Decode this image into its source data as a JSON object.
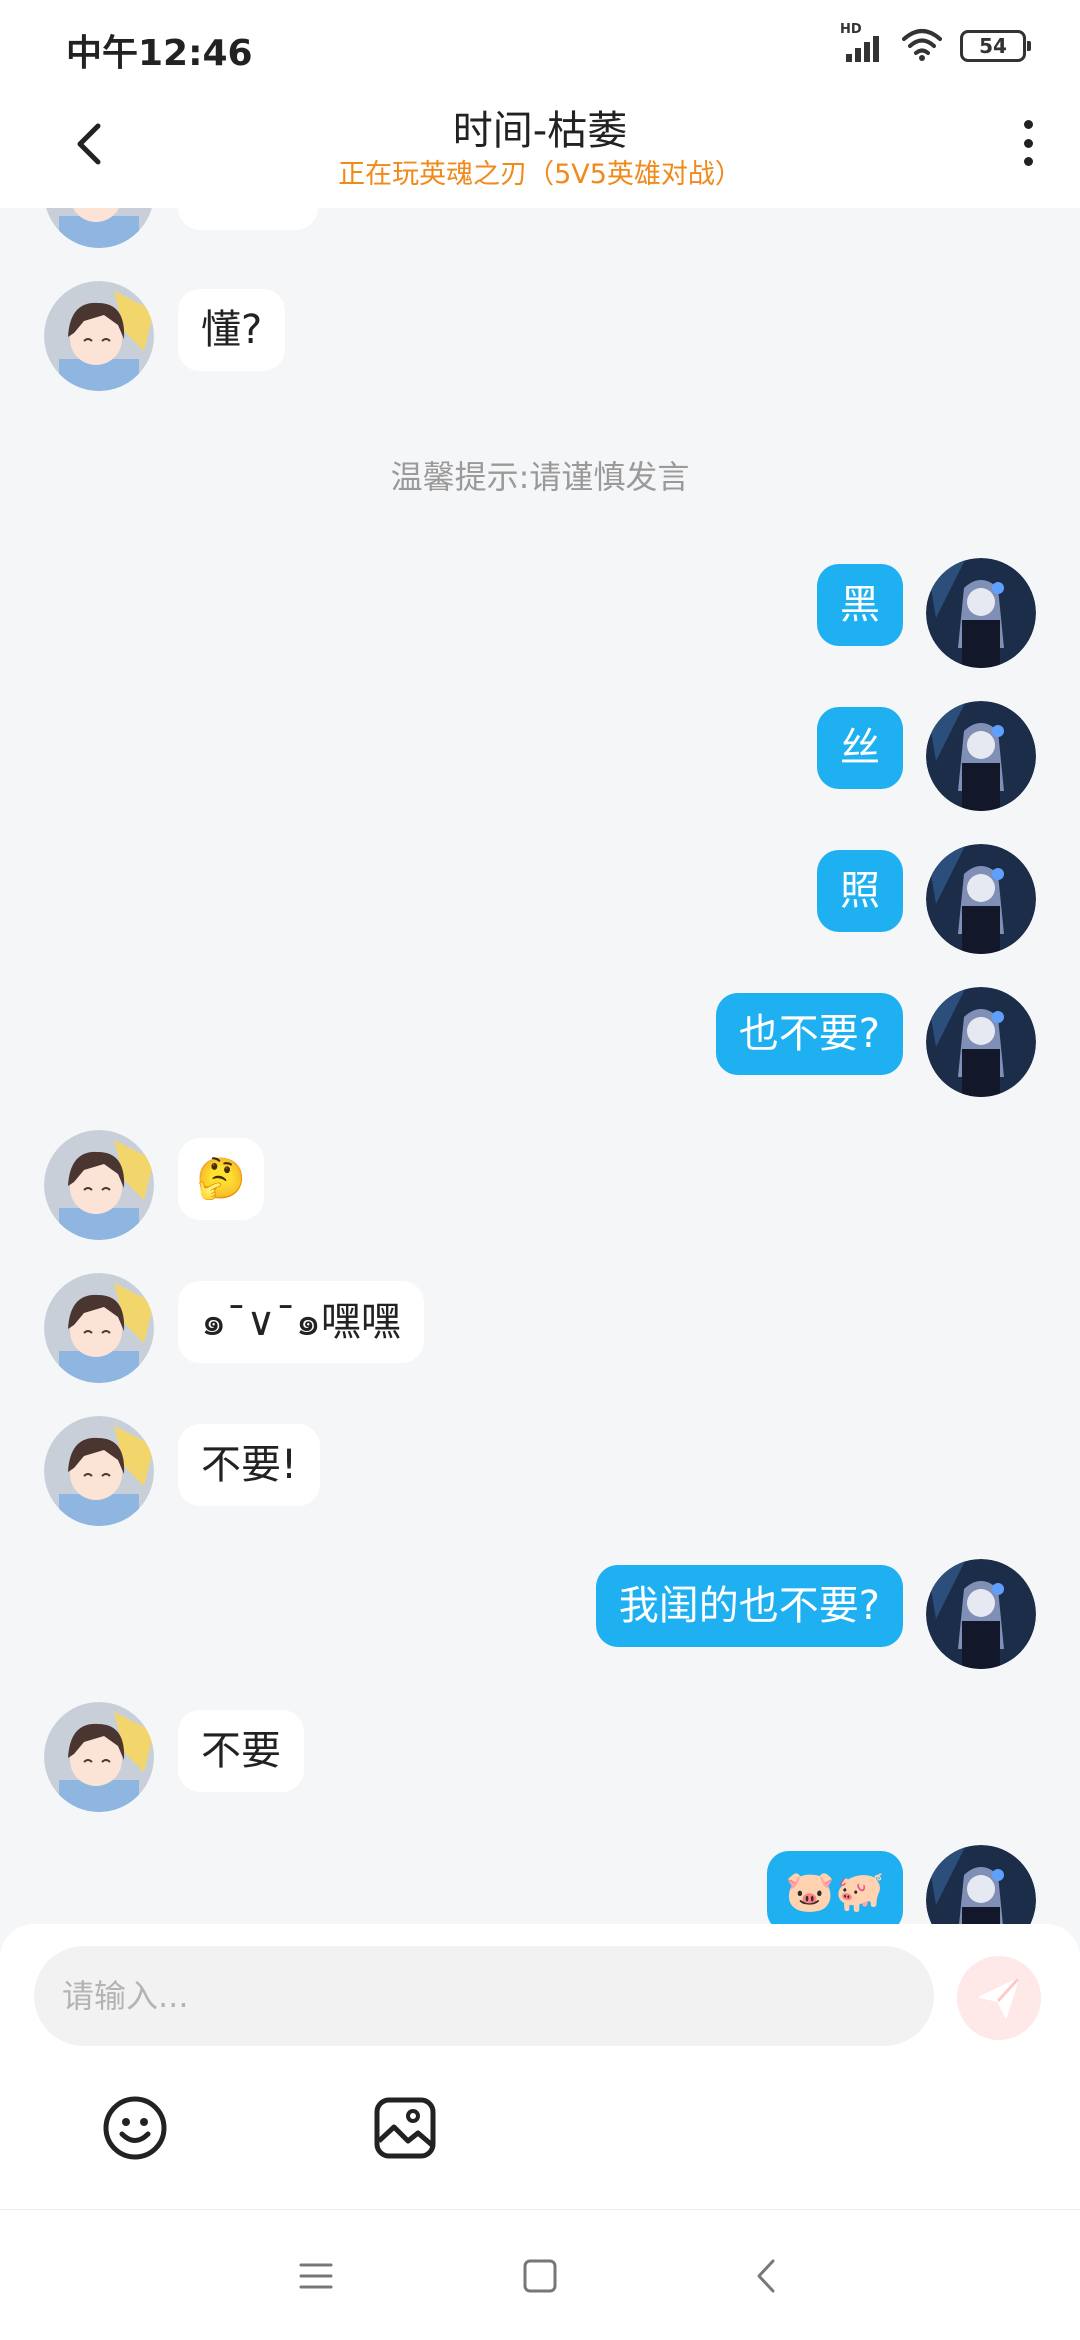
{
  "status_bar": {
    "time": "中午12:46",
    "network_label": "HD",
    "battery": "54",
    "icons": [
      "signal-icon",
      "wifi-icon",
      "battery-icon"
    ]
  },
  "header": {
    "title": "时间-枯萎",
    "subtitle": "正在玩英魂之刃（5V5英雄对战）",
    "back_icon": "chevron-left-icon",
    "more_icon": "more-vertical-icon"
  },
  "chat": {
    "partial_top_bubble": "",
    "system_tip": "温馨提示:请谨慎发言",
    "messages": [
      {
        "side": "left",
        "text": "懂?"
      },
      {
        "side": "right",
        "text": "黑"
      },
      {
        "side": "right",
        "text": "丝"
      },
      {
        "side": "right",
        "text": "照"
      },
      {
        "side": "right",
        "text": "也不要?"
      },
      {
        "side": "left",
        "text": "🤔"
      },
      {
        "side": "left",
        "text": "๑¯∨¯๑嘿嘿"
      },
      {
        "side": "left",
        "text": "不要!"
      },
      {
        "side": "right",
        "text": "我闺的也不要?"
      },
      {
        "side": "left",
        "text": "不要"
      },
      {
        "side": "right",
        "text": "🐷🐖"
      }
    ]
  },
  "input": {
    "placeholder": "请输入...",
    "value": "",
    "send_icon": "send-icon",
    "emoji_icon": "smiley-icon",
    "image_icon": "image-icon"
  },
  "navigation": {
    "icons": [
      "menu-icon",
      "home-square-icon",
      "back-icon"
    ]
  },
  "colors": {
    "accent": "#1eb0f0",
    "subtitle": "#f08a1b",
    "background": "#f5f6f8",
    "send_button": "#ffe8e8"
  }
}
